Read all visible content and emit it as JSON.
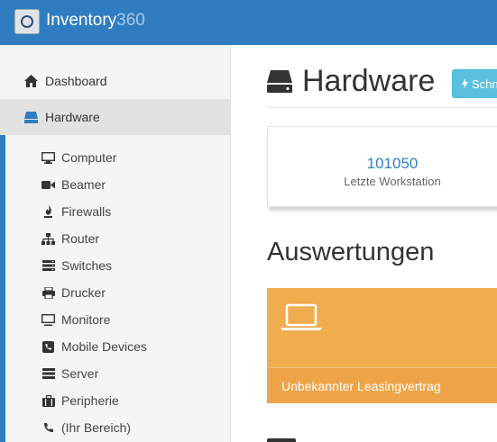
{
  "header": {
    "brand_name": "Inventory",
    "brand_number": "360",
    "logo_icon": "app-logo-icon"
  },
  "sidebar": {
    "main_items": [
      {
        "label": "Dashboard",
        "icon": "home-icon"
      },
      {
        "label": "Hardware",
        "icon": "hard-drive-icon",
        "active": true
      }
    ],
    "sub_items": [
      {
        "label": "Computer",
        "icon": "desktop-icon"
      },
      {
        "label": "Beamer",
        "icon": "video-camera-icon"
      },
      {
        "label": "Firewalls",
        "icon": "fire-icon"
      },
      {
        "label": "Router",
        "icon": "sitemap-icon"
      },
      {
        "label": "Switches",
        "icon": "server-stack-icon"
      },
      {
        "label": "Drucker",
        "icon": "printer-icon"
      },
      {
        "label": "Monitore",
        "icon": "monitor-icon"
      },
      {
        "label": "Mobile Devices",
        "icon": "phone-square-icon"
      },
      {
        "label": "Server",
        "icon": "server-icon"
      },
      {
        "label": "Peripherie",
        "icon": "briefcase-icon"
      },
      {
        "label": "(Ihr Bereich)",
        "icon": "phone-icon"
      }
    ]
  },
  "main": {
    "page_title": "Hardware",
    "quick_button_label": "Schn",
    "stat_card": {
      "value": "101050",
      "label": "Letzte Workstation"
    },
    "section_title": "Auswertungen",
    "report_card": {
      "label": "Unbekannter Leasingvertrag",
      "icon": "laptop-icon"
    }
  },
  "colors": {
    "brand": "#2f7dc0",
    "warning": "#f0ad4e",
    "info": "#5bc0de"
  }
}
